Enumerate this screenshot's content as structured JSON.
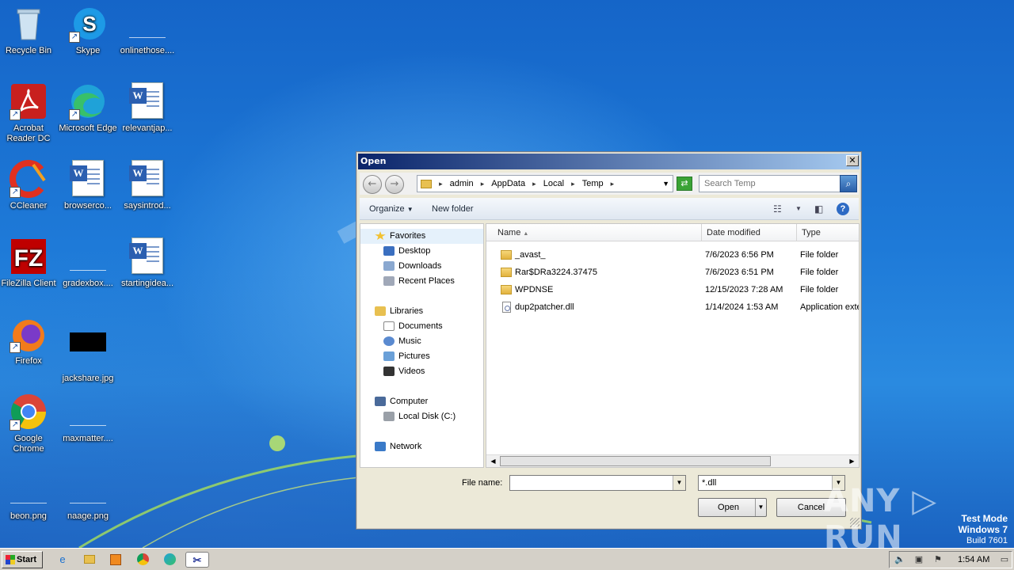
{
  "desktop": {
    "icons": [
      {
        "label": "Recycle Bin"
      },
      {
        "label": "Skype"
      },
      {
        "label": "onlinethose...."
      },
      {
        "label": "Acrobat Reader DC"
      },
      {
        "label": "Microsoft Edge"
      },
      {
        "label": "relevantjap..."
      },
      {
        "label": "CCleaner"
      },
      {
        "label": "browserco..."
      },
      {
        "label": "saysintrod..."
      },
      {
        "label": "FileZilla Client"
      },
      {
        "label": "gradexbox...."
      },
      {
        "label": "startingidea..."
      },
      {
        "label": "Firefox"
      },
      {
        "label": "jackshare.jpg"
      },
      {
        "label": "Google Chrome"
      },
      {
        "label": "maxmatter...."
      },
      {
        "label": "beon.png"
      },
      {
        "label": "naage.png"
      }
    ]
  },
  "dialog": {
    "title": "Open",
    "close_glyph": "✕",
    "address": {
      "segments": [
        "admin",
        "AppData",
        "Local",
        "Temp"
      ]
    },
    "search": {
      "placeholder": "Search Temp"
    },
    "toolbar": {
      "organize": "Organize",
      "new_folder": "New folder"
    },
    "nav": {
      "favorites": "Favorites",
      "desktop": "Desktop",
      "downloads": "Downloads",
      "recent_places": "Recent Places",
      "libraries": "Libraries",
      "documents": "Documents",
      "music": "Music",
      "pictures": "Pictures",
      "videos": "Videos",
      "computer": "Computer",
      "local_disk": "Local Disk (C:)",
      "network": "Network"
    },
    "columns": {
      "name": "Name",
      "date_modified": "Date modified",
      "type": "Type"
    },
    "files": [
      {
        "name": "_avast_",
        "date": "7/6/2023 6:56 PM",
        "type": "File folder"
      },
      {
        "name": "Rar$DRa3224.37475",
        "date": "7/6/2023 6:51 PM",
        "type": "File folder"
      },
      {
        "name": "WPDNSE",
        "date": "12/15/2023 7:28 AM",
        "type": "File folder"
      },
      {
        "name": "dup2patcher.dll",
        "date": "1/14/2024 1:53 AM",
        "type": "Application exte"
      }
    ],
    "file_name_label": "File name:",
    "file_name_value": "",
    "filter_value": "*.dll",
    "open_button": "Open",
    "cancel_button": "Cancel"
  },
  "taskbar": {
    "start_label": "Start",
    "clock": "1:54 AM"
  },
  "watermark": {
    "line1": "Test Mode",
    "line2": "Windows 7",
    "line3": "Build 7601",
    "brand": "ANY ▷ RUN"
  }
}
